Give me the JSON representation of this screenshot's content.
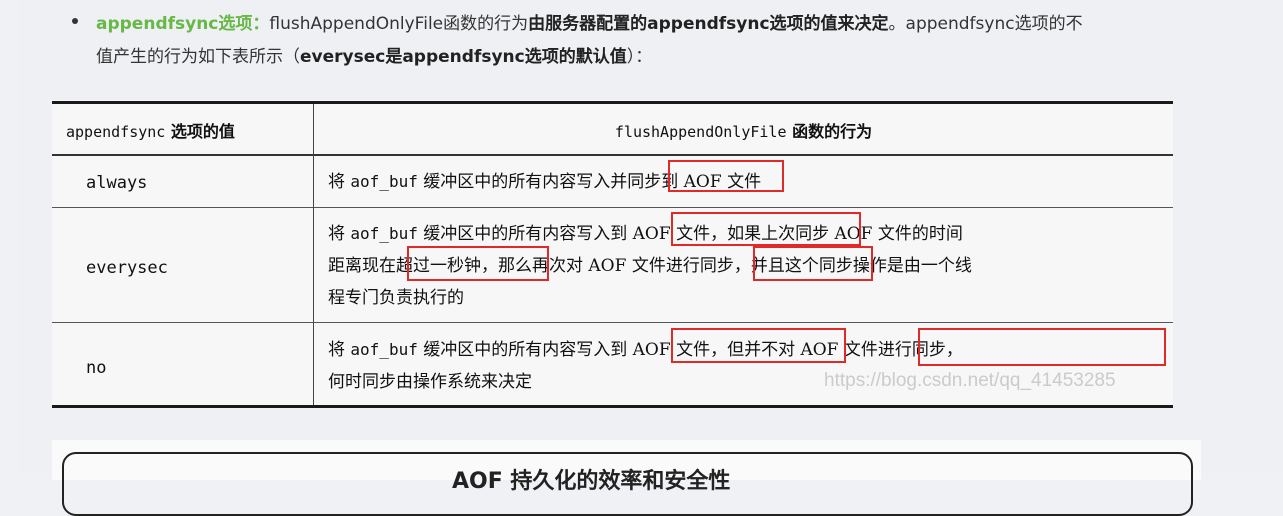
{
  "paragraph": {
    "option_label": "appendfsync选项：",
    "text_1": "flushAppendOnlyFile函数的行为",
    "bold_1": "由服务器配置的appendfsync选项的值来决定",
    "text_2": "。appendfsync选项的不",
    "text_3": "值产生的行为如下表所示（",
    "bold_2": "everysec是appendfsync选项的默认值",
    "text_4": "）："
  },
  "table": {
    "header": {
      "col1_mono": "appendfsync",
      "col1_text": " 选项的值",
      "col2_mono": "flushAppendOnlyFile",
      "col2_text": " 函数的行为"
    },
    "rows": [
      {
        "value": "always",
        "lines": [
          {
            "pre": "将 ",
            "mono": "aof_buf",
            "post": " 缓冲区中的所有内容写入并同步到 AOF 文件"
          }
        ]
      },
      {
        "value": "everysec",
        "lines": [
          {
            "pre": "将 ",
            "mono": "aof_buf",
            "post": " 缓冲区中的所有内容写入到 AOF 文件，如果上次同步 AOF 文件的时间"
          },
          {
            "pre": "",
            "mono": "",
            "post": "距离现在超过一秒钟，那么再次对 AOF 文件进行同步，并且这个同步操作是由一个线"
          },
          {
            "pre": "",
            "mono": "",
            "post": "程专门负责执行的"
          }
        ]
      },
      {
        "value": "no",
        "lines": [
          {
            "pre": "将 ",
            "mono": "aof_buf",
            "post": " 缓冲区中的所有内容写入到 AOF 文件，但并不对 AOF 文件进行同步，"
          },
          {
            "pre": "",
            "mono": "",
            "post": "何时同步由操作系统来决定"
          }
        ]
      }
    ],
    "watermark": "https://blog.csdn.net/qq_41453285",
    "highlight_color": "#e02a2a"
  },
  "next_figure": {
    "partial_title": "AOF 持久化的效率和安全性"
  }
}
